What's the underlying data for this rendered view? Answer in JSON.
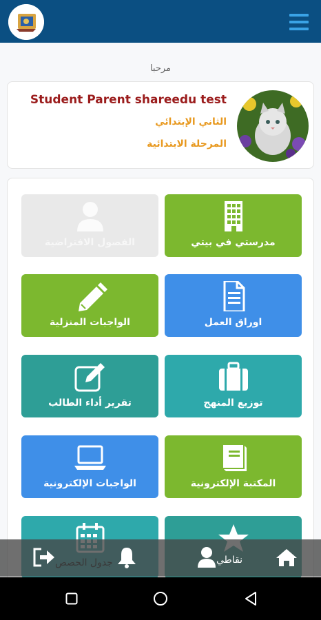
{
  "header": {
    "logo_icon": "school-logo-icon",
    "menu_icon": "hamburger-menu-icon",
    "bar_color": "#0b4f82"
  },
  "greeting": "مرحبا",
  "profile": {
    "name": "Student Parent shareedu test",
    "grade": "الثاني الإبتدائي",
    "stage": "المرحلة الابتدائية",
    "avatar_icon": "kitten-photo-avatar"
  },
  "tiles": [
    {
      "label": "مدرستي في بيتي",
      "icon": "building-icon",
      "color": "#7cb82f"
    },
    {
      "label": "الفصول الافتراضية",
      "icon": "user-icon",
      "color": "#e9e9e9"
    },
    {
      "label": "اوراق العمل",
      "icon": "document-icon",
      "color": "#3f8fe8"
    },
    {
      "label": "الواجبات المنزلية",
      "icon": "pencil-icon",
      "color": "#7cb82f"
    },
    {
      "label": "توزيع المنهج",
      "icon": "suitcase-icon",
      "color": "#2ea9ab"
    },
    {
      "label": "تقرير أداء الطالب",
      "icon": "edit-icon",
      "color": "#2e9e96"
    },
    {
      "label": "المكتبة الإلكترونية",
      "icon": "book-icon",
      "color": "#7cb82f"
    },
    {
      "label": "الواجبات الإلكترونية",
      "icon": "laptop-icon",
      "color": "#3f8fe8"
    },
    {
      "label": "نقاطي",
      "icon": "star-icon",
      "color": "#2e9e96"
    },
    {
      "label": "جدول الحصص",
      "icon": "calendar-icon",
      "color": "#2ea9ab"
    }
  ],
  "bottom_nav": {
    "home_icon": "home-icon",
    "profile_label": "نقاطي",
    "profile_icon": "user-icon",
    "notifications_icon": "bell-icon",
    "schedule_label": "جدول الحصص",
    "logout_icon": "logout-icon"
  },
  "system_nav": {
    "back_icon": "back-triangle-icon",
    "home_icon": "home-circle-icon",
    "recents_icon": "recents-square-icon"
  }
}
